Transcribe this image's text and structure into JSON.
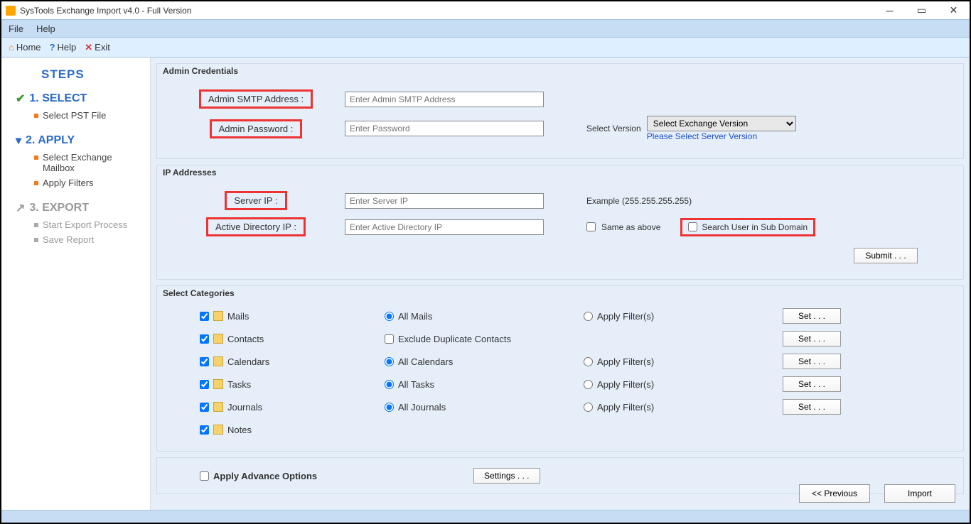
{
  "window": {
    "title": "SysTools Exchange Import v4.0 - Full Version"
  },
  "menubar": {
    "file": "File",
    "help": "Help"
  },
  "toolbar": {
    "home": "Home",
    "help": "Help",
    "exit": "Exit"
  },
  "sidebar": {
    "title": "STEPS",
    "step1": {
      "label": "1. SELECT",
      "items": [
        "Select PST File"
      ]
    },
    "step2": {
      "label": "2. APPLY",
      "items": [
        "Select Exchange Mailbox",
        "Apply Filters"
      ]
    },
    "step3": {
      "label": "3. EXPORT",
      "items": [
        "Start Export Process",
        "Save Report"
      ]
    }
  },
  "admin": {
    "group_title": "Admin Credentials",
    "smtp_label": "Admin SMTP Address :",
    "smtp_placeholder": "Enter Admin SMTP Address",
    "pwd_label": "Admin Password :",
    "pwd_placeholder": "Enter Password",
    "select_version_label": "Select Version",
    "select_version_option": "Select Exchange Version",
    "select_version_hint": "Please Select Server Version"
  },
  "ip": {
    "group_title": "IP Addresses",
    "server_label": "Server IP :",
    "server_placeholder": "Enter Server IP",
    "example_text": "Example (255.255.255.255)",
    "ad_label": "Active Directory IP :",
    "ad_placeholder": "Enter Active Directory IP",
    "same_as_above": "Same as above",
    "search_sub": "Search User in Sub Domain",
    "submit": "Submit . . ."
  },
  "categories": {
    "group_title": "Select Categories",
    "rows": [
      {
        "name": "Mails",
        "opt_all": "All Mails",
        "opt_filter": "Apply Filter(s)",
        "set": "Set . . .",
        "type": "radio"
      },
      {
        "name": "Contacts",
        "opt_all": "Exclude Duplicate Contacts",
        "opt_filter": "",
        "set": "Set . . .",
        "type": "checkbox"
      },
      {
        "name": "Calendars",
        "opt_all": "All Calendars",
        "opt_filter": "Apply Filter(s)",
        "set": "Set . . .",
        "type": "radio"
      },
      {
        "name": "Tasks",
        "opt_all": "All Tasks",
        "opt_filter": "Apply Filter(s)",
        "set": "Set . . .",
        "type": "radio"
      },
      {
        "name": "Journals",
        "opt_all": "All Journals",
        "opt_filter": "Apply Filter(s)",
        "set": "Set . . .",
        "type": "radio"
      },
      {
        "name": "Notes",
        "opt_all": "",
        "opt_filter": "",
        "set": "",
        "type": ""
      }
    ]
  },
  "advance": {
    "label": "Apply Advance Options",
    "settings": "Settings . . ."
  },
  "nav": {
    "previous": "<< Previous",
    "import": "Import"
  }
}
